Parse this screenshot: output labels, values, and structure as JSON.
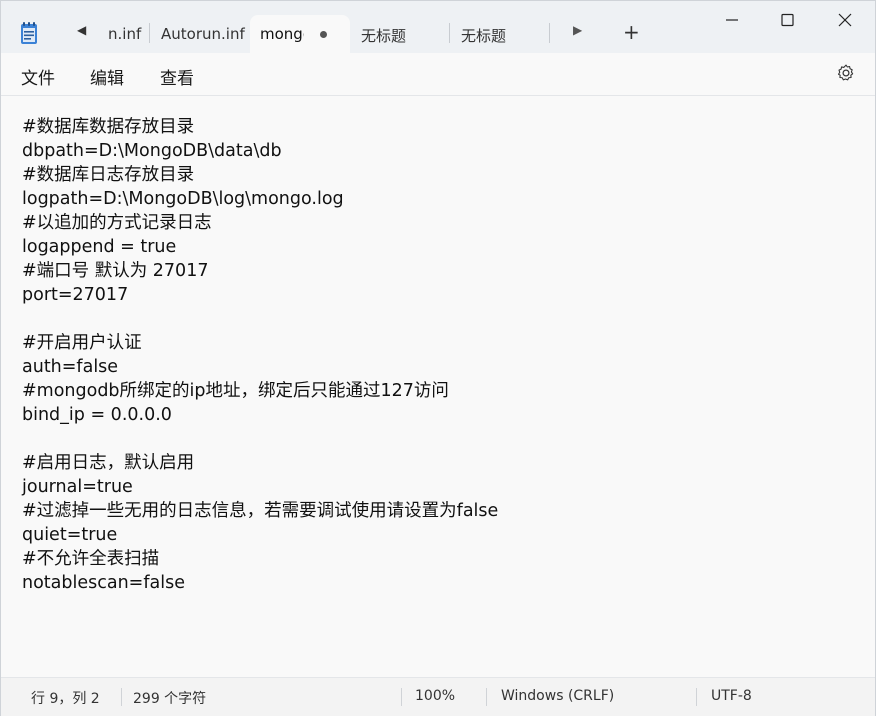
{
  "tabs": [
    {
      "label": "n.inf"
    },
    {
      "label": "Autorun.inf"
    },
    {
      "label": "mongo",
      "active": true,
      "modified": true
    },
    {
      "label": "无标题"
    },
    {
      "label": "无标题"
    }
  ],
  "menu": {
    "file": "文件",
    "edit": "编辑",
    "view": "查看"
  },
  "editor": {
    "lines": [
      "#数据库数据存放目录",
      "dbpath=D:\\MongoDB\\data\\db",
      "#数据库日志存放目录",
      "logpath=D:\\MongoDB\\log\\mongo.log",
      "#以追加的方式记录日志",
      "logappend = true",
      "#端口号 默认为 27017",
      "port=27017",
      "",
      "#开启用户认证",
      "auth=false",
      "#mongodb所绑定的ip地址，绑定后只能通过127访问",
      "bind_ip = 0.0.0.0",
      "",
      "#启用日志，默认启用",
      "journal=true",
      "#过滤掉一些无用的日志信息，若需要调试使用请设置为false",
      "quiet=true",
      "#不允许全表扫描",
      "notablescan=false"
    ]
  },
  "status": {
    "position": "行 9，列 2",
    "chars": "299 个字符",
    "zoom": "100%",
    "line_ending": "Windows (CRLF)",
    "encoding": "UTF-8"
  },
  "icons": {
    "app": "notepad-icon",
    "scroll_left": "caret-left-icon",
    "scroll_right": "caret-right-icon",
    "new_tab": "plus-icon",
    "minimize": "minimize-icon",
    "maximize": "maximize-icon",
    "close": "close-icon",
    "settings": "gear-icon"
  },
  "colors": {
    "accent": "#3a7bd5",
    "chrome": "#eef1f4",
    "editor_bg": "#f9f9f9"
  }
}
